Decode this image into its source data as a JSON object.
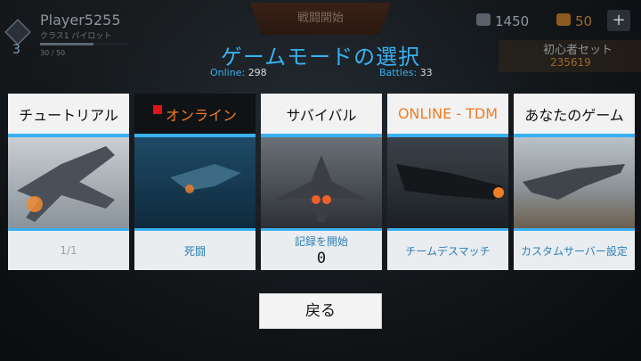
{
  "player": {
    "rank": "3",
    "name": "Player5255",
    "class": "クラス1 パイロット",
    "xp": "30 / 50",
    "xp_fraction": 0.6
  },
  "header": {
    "battle_start": "戦闘開始",
    "silver": "1450",
    "gold": "50",
    "plus": "+",
    "starter_title": "初心者セット",
    "starter_price": "235619"
  },
  "title": "ゲームモードの選択",
  "stats": {
    "online_label": "Online:",
    "online_value": "298",
    "battles_label": "Battles:",
    "battles_value": "33"
  },
  "modes": [
    {
      "label": "チュートリアル",
      "footer": "1/1"
    },
    {
      "label": "オンライン",
      "footer": "死闘"
    },
    {
      "label": "サバイバル",
      "footer": "記録を開始",
      "footer_value": "0"
    },
    {
      "label": "ONLINE - TDM",
      "footer": "チームデスマッチ"
    },
    {
      "label": "あなたのゲーム",
      "footer": "カスタムサーバー設定"
    }
  ],
  "back_label": "戻る",
  "colors": {
    "accent": "#39b0f0",
    "highlight": "#f07d25",
    "gold": "#9c6a2a"
  }
}
